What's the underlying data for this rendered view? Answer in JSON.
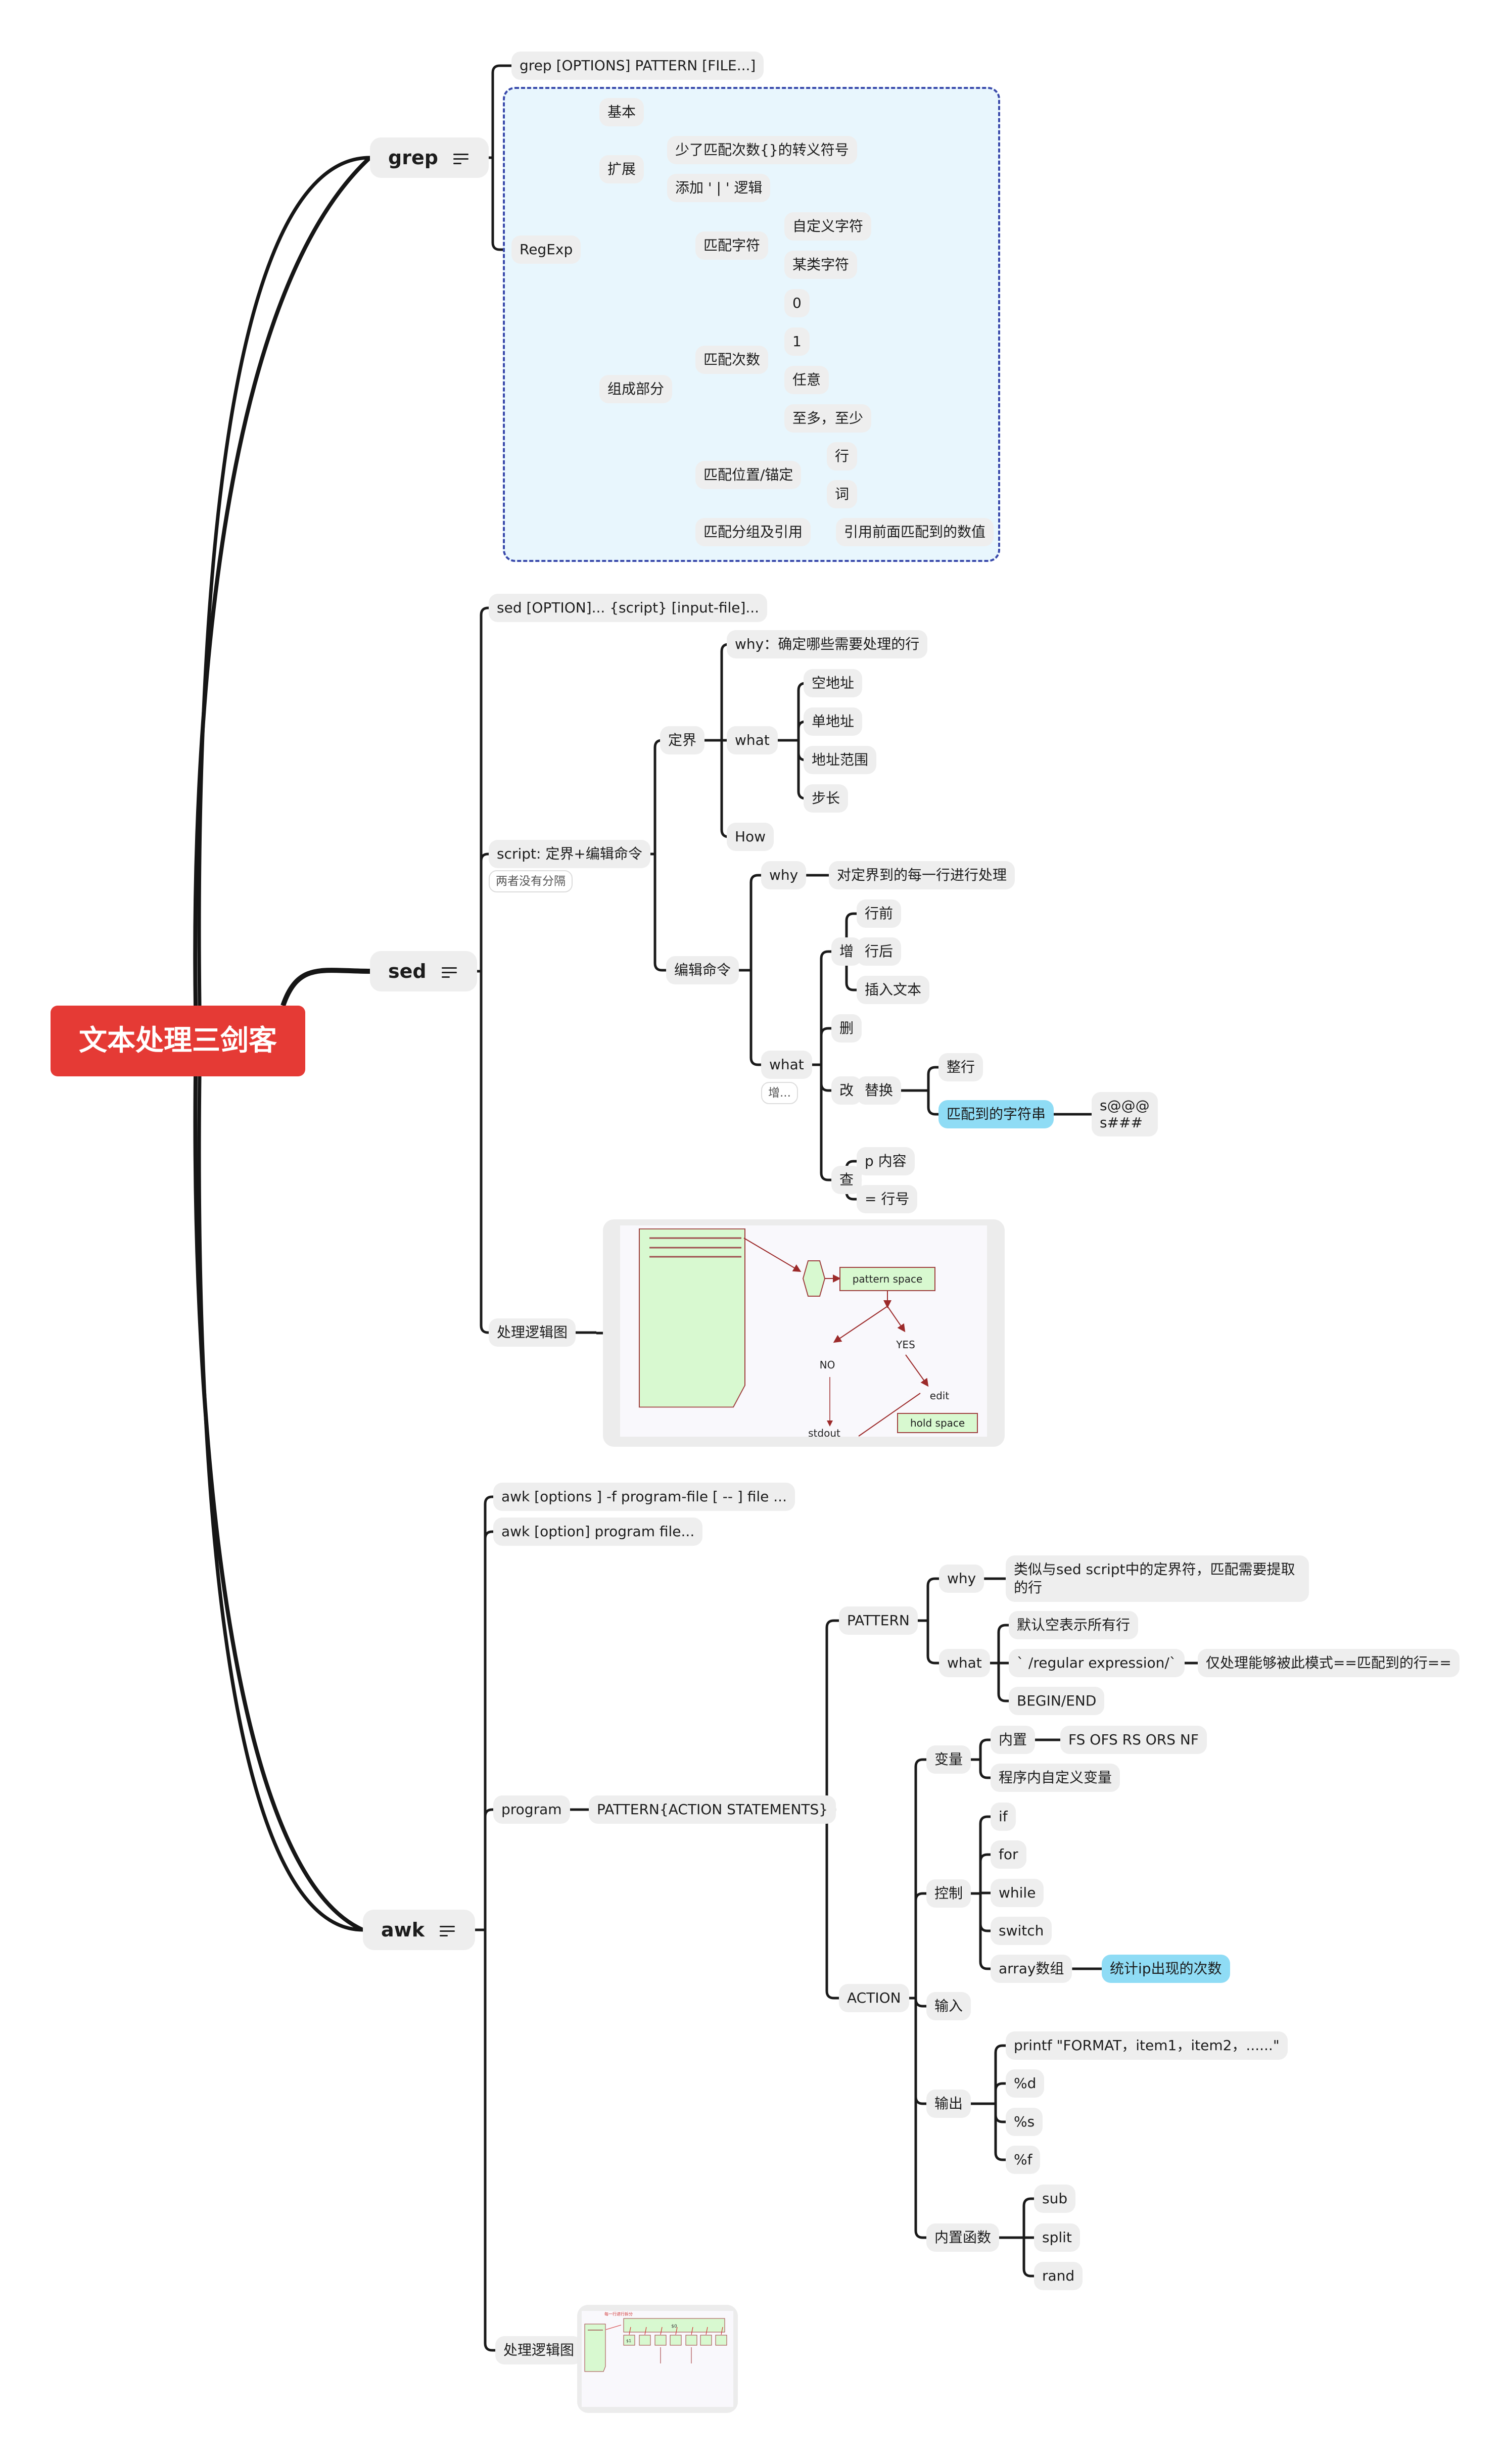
{
  "root": {
    "label": "文本处理三剑客",
    "color": "#e53a35"
  },
  "grep": {
    "label": "grep",
    "syntax": "grep [OPTIONS] PATTERN [FILE...]",
    "regexp": {
      "label": "RegExp",
      "basic": "基本",
      "extended": {
        "label": "扩展",
        "items": [
          "少了匹配次数{}的转义符号",
          "添加 ' | ' 逻辑"
        ]
      },
      "components": {
        "label": "组成部分",
        "match_chars": {
          "label": "匹配字符",
          "items": [
            "自定义字符",
            "某类字符"
          ]
        },
        "match_count": {
          "label": "匹配次数",
          "items": [
            "0",
            "1",
            "任意",
            "至多，至少"
          ]
        },
        "match_anchor": {
          "label": "匹配位置/锚定",
          "items": [
            "行",
            "词"
          ]
        },
        "match_group": {
          "label": "匹配分组及引用",
          "items": [
            "引用前面匹配到的数值"
          ]
        }
      }
    }
  },
  "sed": {
    "label": "sed",
    "syntax": "sed [OPTION]... {script} [input-file]...",
    "script": {
      "label": "script: 定界+编辑命令",
      "note": "两者没有分隔",
      "address": {
        "label": "定界",
        "why": "why：确定哪些需要处理的行",
        "what": {
          "label": "what",
          "items": [
            "空地址",
            "单地址",
            "地址范围",
            "步长"
          ]
        },
        "how": "How"
      },
      "edit": {
        "label": "编辑命令",
        "why": {
          "label": "why",
          "detail": "对定界到的每一行进行处理"
        },
        "what": {
          "label": "what",
          "note": "增...",
          "add": {
            "label": "增",
            "items": [
              "行前",
              "行后",
              "插入文本"
            ]
          },
          "delete": "删",
          "change": {
            "label": "改",
            "replace": {
              "label": "替换",
              "whole_line": "整行",
              "matched": {
                "label": "匹配到的字符串",
                "detail": [
                  "s@@@",
                  "s###"
                ]
              }
            }
          },
          "query": {
            "label": "查",
            "items": [
              "p 内容",
              "= 行号"
            ]
          }
        }
      }
    },
    "logic": {
      "label": "处理逻辑图",
      "diagram": {
        "pattern_space": "pattern space",
        "yes": "YES",
        "no": "NO",
        "edit": "edit",
        "stdout": "stdout",
        "hold_space": "hold space"
      }
    }
  },
  "awk": {
    "label": "awk",
    "syntax1": "awk [options ] -f program-file [ -- ] file ...",
    "syntax2": "awk [option] program file...",
    "program": {
      "label": "program",
      "form": "PATTERN{ACTION STATEMENTS}",
      "pattern": {
        "label": "PATTERN",
        "why": {
          "label": "why",
          "detail": "类似与sed script中的定界符，匹配需要提取的行"
        },
        "what": {
          "label": "what",
          "items": [
            "默认空表示所有行",
            "` /regular expression/`",
            "BEGIN/END"
          ],
          "regex_detail": "仅处理能够被此模式==匹配到的行=="
        }
      },
      "action": {
        "label": "ACTION",
        "vars": {
          "label": "变量",
          "builtin": "内置",
          "builtin_detail": "FS OFS RS ORS NF",
          "custom": "程序内自定义变量"
        },
        "control": {
          "label": "控制",
          "items": [
            "if",
            "for",
            "while",
            "switch",
            "array数组"
          ],
          "array_detail": "统计ip出现的次数"
        },
        "input": "输入",
        "output": {
          "label": "输出",
          "items": [
            "printf \"FORMAT，item1，item2，......\"",
            "%d",
            "%s",
            "%f"
          ]
        },
        "functions": {
          "label": "内置函数",
          "items": [
            "sub",
            "split",
            "rand"
          ]
        }
      }
    },
    "logic": {
      "label": "处理逻辑图",
      "diagram": {
        "title": "每一行进行拆分",
        "whole": "$0",
        "field1": "$1"
      }
    }
  },
  "colors": {
    "boundary": "#3949ab",
    "boundary_fill": "#e8f6fd",
    "highlight": "#8fdcf5",
    "node_bg": "#eeeeee"
  }
}
